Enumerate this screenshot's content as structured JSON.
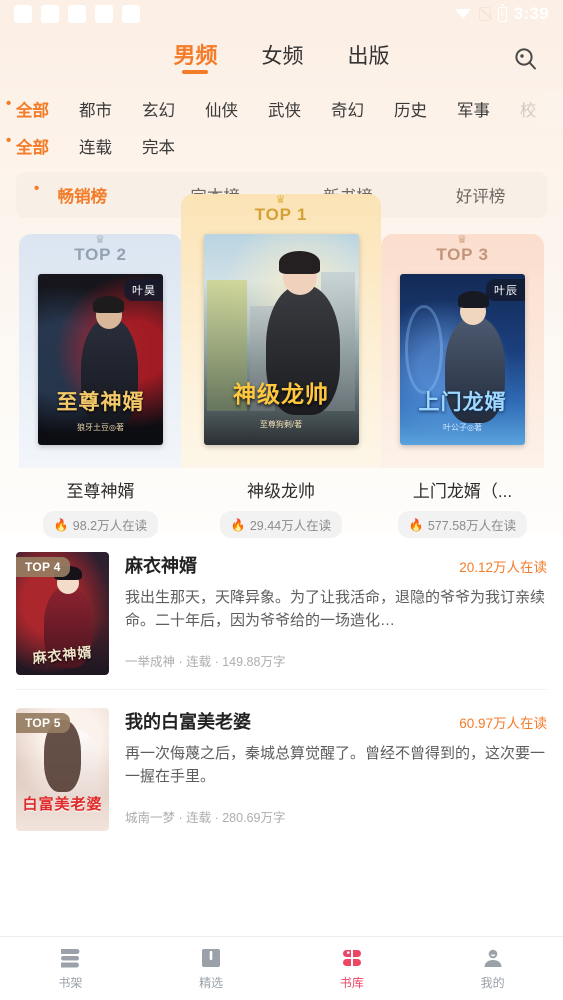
{
  "status_bar": {
    "time": "3:39",
    "placeholder_count": 5,
    "icons": [
      "wifi-icon",
      "signal-icon",
      "battery-icon"
    ]
  },
  "header": {
    "tabs": [
      {
        "label": "男频",
        "active": true
      },
      {
        "label": "女频",
        "active": false
      },
      {
        "label": "出版",
        "active": false
      }
    ],
    "search_icon": "search-icon"
  },
  "filters": {
    "genre_row": [
      {
        "label": "全部",
        "active": true
      },
      {
        "label": "都市",
        "active": false
      },
      {
        "label": "玄幻",
        "active": false
      },
      {
        "label": "仙侠",
        "active": false
      },
      {
        "label": "武侠",
        "active": false
      },
      {
        "label": "奇幻",
        "active": false
      },
      {
        "label": "历史",
        "active": false
      },
      {
        "label": "军事",
        "active": false
      },
      {
        "label": "校",
        "active": false,
        "clipped": true
      }
    ],
    "status_row": [
      {
        "label": "全部",
        "active": true
      },
      {
        "label": "连载",
        "active": false
      },
      {
        "label": "完本",
        "active": false
      }
    ]
  },
  "rank_tabs": [
    {
      "label": "畅销榜",
      "active": true
    },
    {
      "label": "完本榜",
      "active": false
    },
    {
      "label": "新书榜",
      "active": false
    },
    {
      "label": "好评榜",
      "active": false
    }
  ],
  "podium": [
    {
      "rank_label": "TOP 2",
      "title": "至尊神婿",
      "heat": "98.2万人在读",
      "author_tag": "叶昊",
      "cover_title": "至尊神婿",
      "cover_byline": "狼牙土豆◎著",
      "crown": "♛",
      "flame": "🔥"
    },
    {
      "rank_label": "TOP 1",
      "title": "神级龙帅",
      "heat": "29.44万人在读",
      "author_tag": "",
      "cover_title": "神级龙帅",
      "cover_byline": "至尊狗剩/著",
      "crown": "♛",
      "flame": "🔥"
    },
    {
      "rank_label": "TOP 3",
      "title": "上门龙婿（...",
      "heat": "577.58万人在读",
      "author_tag": "叶辰",
      "cover_title": "上门龙婿",
      "cover_byline": "叶公子◎著",
      "crown": "♛",
      "flame": "🔥"
    }
  ],
  "list": [
    {
      "rank_tag": "TOP 4",
      "title": "麻衣神婿",
      "heat": "20.12万人在读",
      "desc": "我出生那天，天降异象。为了让我活命，退隐的爷爷为我订亲续命。二十年后，因为爷爷给的一场造化…",
      "meta": "一举成神 · 连载 · 149.88万字",
      "cover_title": "麻衣神婿"
    },
    {
      "rank_tag": "TOP 5",
      "title": "我的白富美老婆",
      "heat": "60.97万人在读",
      "desc": "再一次侮蔑之后，秦城总算觉醒了。曾经不曾得到的，这次要一一握在手里。",
      "meta": "城南一梦 · 连载 · 280.69万字",
      "cover_title": "白富美老婆"
    }
  ],
  "bottom_nav": [
    {
      "label": "书架",
      "icon": "bookshelf-icon",
      "active": false
    },
    {
      "label": "精选",
      "icon": "open-book-icon",
      "active": false
    },
    {
      "label": "书库",
      "icon": "library-clover-icon",
      "active": true
    },
    {
      "label": "我的",
      "icon": "person-icon",
      "active": false
    }
  ],
  "colors": {
    "accent_orange": "#F47B28",
    "accent_red": "#ED4565",
    "gold": "#D5A036",
    "silver": "#93A1B1",
    "bronze": "#C2957B"
  }
}
